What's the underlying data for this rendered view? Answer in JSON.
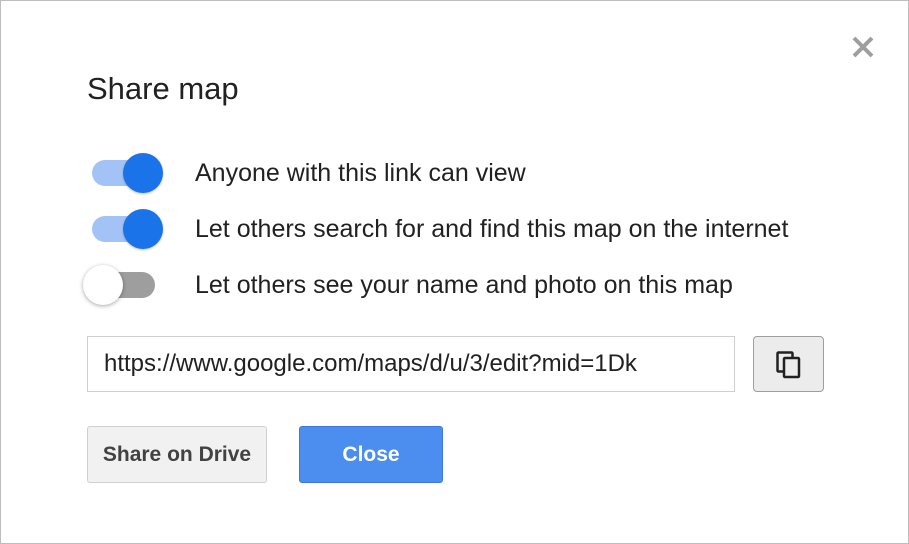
{
  "dialog": {
    "title": "Share map",
    "close_icon": "close-icon"
  },
  "options": [
    {
      "label": "Anyone with this link can view",
      "enabled": true
    },
    {
      "label": "Let others search for and find this map on the internet",
      "enabled": true
    },
    {
      "label": "Let others see your name and photo on this map",
      "enabled": false
    }
  ],
  "link": {
    "value": "https://www.google.com/maps/d/u/3/edit?mid=1Dk",
    "copy_icon": "copy-icon"
  },
  "buttons": {
    "share_on_drive": "Share on Drive",
    "close": "Close"
  },
  "colors": {
    "accent": "#1a73e8",
    "toggle_track_on": "#a3c3f7",
    "toggle_track_off": "#9e9e9e",
    "primary_button": "#4c8ef0"
  }
}
